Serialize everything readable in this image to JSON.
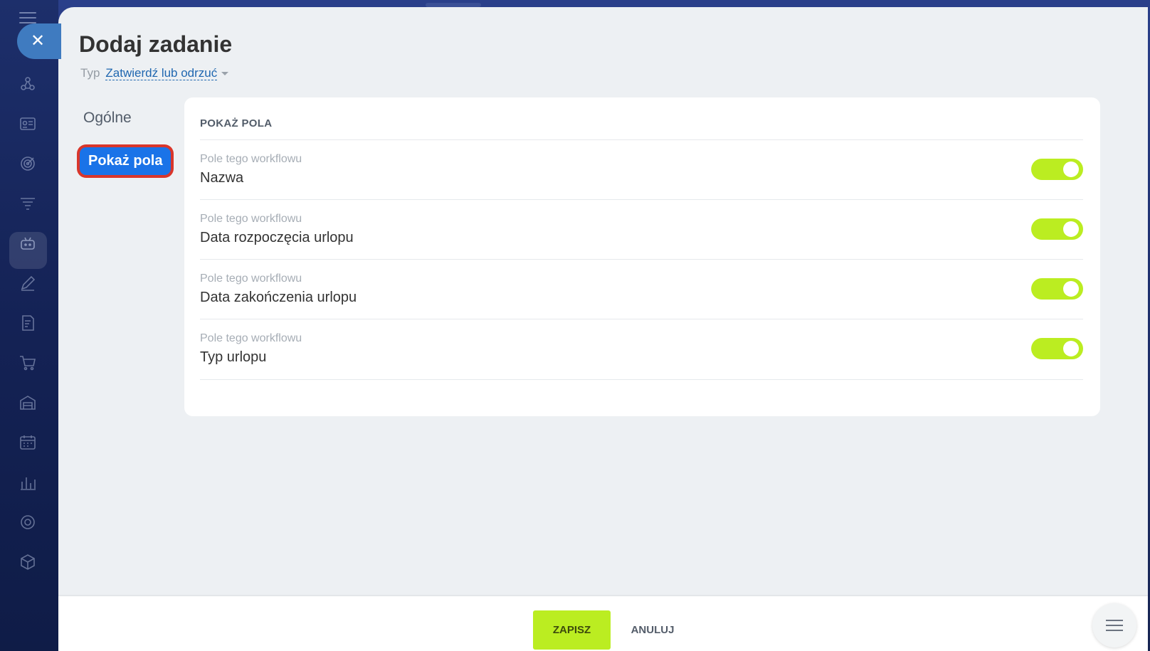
{
  "dialog": {
    "title": "Dodaj zadanie",
    "type_label": "Typ",
    "type_value": "Zatwierdź lub odrzuć"
  },
  "nav": {
    "items": [
      {
        "label": "Ogólne"
      },
      {
        "label": "Pokaż pola"
      }
    ],
    "active": "Pokaż pola"
  },
  "section": {
    "header": "POKAŻ POLA",
    "fields": [
      {
        "source": "Pole tego workflowu",
        "name": "Nazwa",
        "enabled": true
      },
      {
        "source": "Pole tego workflowu",
        "name": "Data rozpoczęcia urlopu",
        "enabled": true
      },
      {
        "source": "Pole tego workflowu",
        "name": "Data zakończenia urlopu",
        "enabled": true
      },
      {
        "source": "Pole tego workflowu",
        "name": "Typ urlopu",
        "enabled": true
      }
    ]
  },
  "footer": {
    "save_label": "ZAPISZ",
    "cancel_label": "ANULUJ"
  },
  "colors": {
    "accent_green": "#bbed21",
    "active_tab_blue": "#1a73e8",
    "highlight_red": "#d9362b",
    "link_blue": "#2067b0"
  },
  "sidebar_icons": [
    "crm-icon",
    "contacts-icon",
    "target-icon",
    "filter-icon",
    "robot-icon",
    "pen-icon",
    "document-icon",
    "cart-icon",
    "warehouse-icon",
    "calendar-icon",
    "chart-icon",
    "settings-icon",
    "box-icon"
  ]
}
